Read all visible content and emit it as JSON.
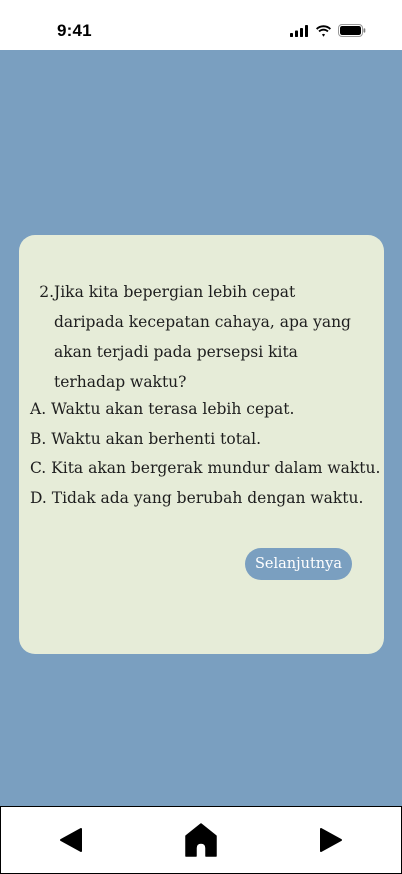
{
  "status_bar": {
    "time": "9:41",
    "icons": [
      "cellular-signal-icon",
      "wifi-icon",
      "battery-icon"
    ]
  },
  "quiz": {
    "question_number": "2.",
    "question_text": "Jika kita bepergian lebih cepat daripada kecepatan cahaya, apa yang akan terjadi pada persepsi kita terhadap waktu?",
    "options": [
      "A. Waktu akan terasa lebih cepat.",
      "B. Waktu akan berhenti total.",
      "C. Kita akan bergerak mundur dalam waktu.",
      "D. Tidak ada yang berubah dengan waktu."
    ],
    "next_label": "Selanjutnya"
  },
  "bottom_nav": {
    "icons": [
      "back-arrow-icon",
      "home-icon",
      "forward-arrow-icon"
    ]
  },
  "colors": {
    "background": "#7a9fc0",
    "card": "#e6ecd8",
    "button": "#7a9fc0",
    "text": "#1e1e1e"
  }
}
